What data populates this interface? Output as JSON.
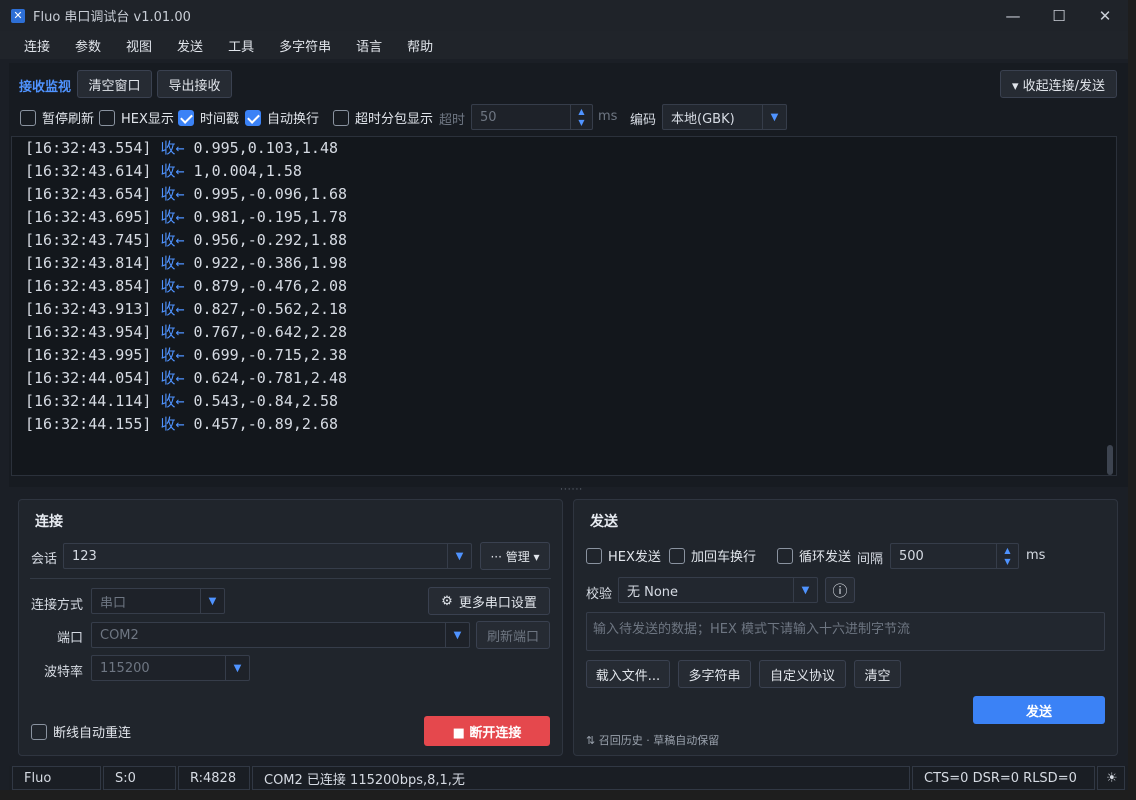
{
  "window": {
    "title": "Fluo 串口调试台 v1.01.00",
    "minimize": "—",
    "maximize": "☐",
    "close": "✕"
  },
  "menu": [
    "连接",
    "参数",
    "视图",
    "发送",
    "工具",
    "多字符串",
    "语言",
    "帮助"
  ],
  "receive": {
    "title": "接收监视",
    "clear_button": "清空窗口",
    "export_button": "导出接收",
    "collapse_button": "▾ 收起连接/发送",
    "options": {
      "pause": "暂停刷新",
      "hex": "HEX显示",
      "timestamp": "时间戳",
      "autowrap": "自动换行",
      "timeout_split": "超时分包显示",
      "timeout_label": "超时",
      "timeout_value": "50",
      "timeout_unit": "ms",
      "encoding_label": "编码",
      "encoding_value": "本地(GBK)"
    },
    "log": [
      {
        "time": "[16:32:43.554]",
        "dir": "收←",
        "data": "0.995,0.103,1.48"
      },
      {
        "time": "[16:32:43.614]",
        "dir": "收←",
        "data": "1,0.004,1.58"
      },
      {
        "time": "[16:32:43.654]",
        "dir": "收←",
        "data": "0.995,-0.096,1.68"
      },
      {
        "time": "[16:32:43.695]",
        "dir": "收←",
        "data": "0.981,-0.195,1.78"
      },
      {
        "time": "[16:32:43.745]",
        "dir": "收←",
        "data": "0.956,-0.292,1.88"
      },
      {
        "time": "[16:32:43.814]",
        "dir": "收←",
        "data": "0.922,-0.386,1.98"
      },
      {
        "time": "[16:32:43.854]",
        "dir": "收←",
        "data": "0.879,-0.476,2.08"
      },
      {
        "time": "[16:32:43.913]",
        "dir": "收←",
        "data": "0.827,-0.562,2.18"
      },
      {
        "time": "[16:32:43.954]",
        "dir": "收←",
        "data": "0.767,-0.642,2.28"
      },
      {
        "time": "[16:32:43.995]",
        "dir": "收←",
        "data": "0.699,-0.715,2.38"
      },
      {
        "time": "[16:32:44.054]",
        "dir": "收←",
        "data": "0.624,-0.781,2.48"
      },
      {
        "time": "[16:32:44.114]",
        "dir": "收←",
        "data": "0.543,-0.84,2.58"
      },
      {
        "time": "[16:32:44.155]",
        "dir": "收←",
        "data": "0.457,-0.89,2.68"
      }
    ]
  },
  "connection": {
    "title": "连接",
    "session_label": "会话",
    "session_value": "123",
    "manage_button": "··· 管理 ▾",
    "method_label": "连接方式",
    "method_value": "串口",
    "more_settings_button": "更多串口设置",
    "port_label": "端口",
    "port_value": "COM2",
    "refresh_button": "刷新端口",
    "baud_label": "波特率",
    "baud_value": "115200",
    "auto_reconnect": "断线自动重连",
    "disconnect_button": "■ 断开连接"
  },
  "send": {
    "title": "发送",
    "hex_send": "HEX发送",
    "add_crlf": "加回车换行",
    "loop_send": "循环发送",
    "interval_label": "间隔",
    "interval_value": "500",
    "interval_unit": "ms",
    "checksum_label": "校验",
    "checksum_value": "无 None",
    "info_icon": "ⓘ",
    "input_placeholder": "输入待发送的数据；HEX 模式下请输入十六进制字节流",
    "load_file_button": "载入文件...",
    "multi_string_button": "多字符串",
    "custom_protocol_button": "自定义协议",
    "clear_button": "清空",
    "send_button": "发送",
    "history_hint": "⇅ 召回历史 · 草稿自动保留"
  },
  "status": {
    "app": "Fluo",
    "sent": "S:0",
    "received": "R:4828",
    "connection": "COM2 已连接 115200bps,8,1,无",
    "signals": "CTS=0  DSR=0  RLSD=0",
    "theme_icon": "☀"
  }
}
